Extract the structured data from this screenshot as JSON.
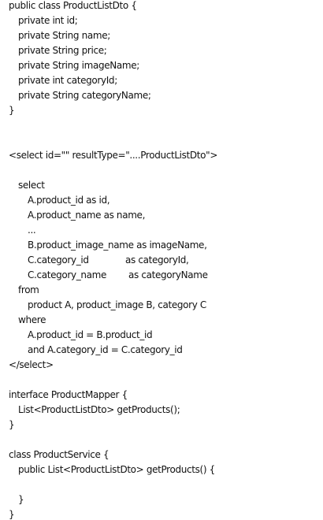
{
  "lines": [
    "public class ProductListDto {",
    "private int id;",
    "private String name;",
    "private String price;",
    "private String imageName;",
    "private int categoryId;",
    "private String categoryName;",
    "}",
    "<select id=\"\" resultType=\"....ProductListDto\">",
    "select",
    "A.product_id as id,",
    "A.product_name as name,",
    "...",
    "B.product_image_name as imageName,",
    "C.category_id",
    "as categoryId,",
    "C.category_name",
    "as categoryName",
    "from",
    "product A, product_image B, category C",
    "where",
    "A.product_id = B.product_id",
    "and A.category_id = C.category_id",
    "</select>",
    "interface ProductMapper {",
    "List<ProductListDto> getProducts();",
    "}",
    "class ProductService {",
    "public List<ProductListDto> getProducts() {",
    "}",
    "}"
  ]
}
